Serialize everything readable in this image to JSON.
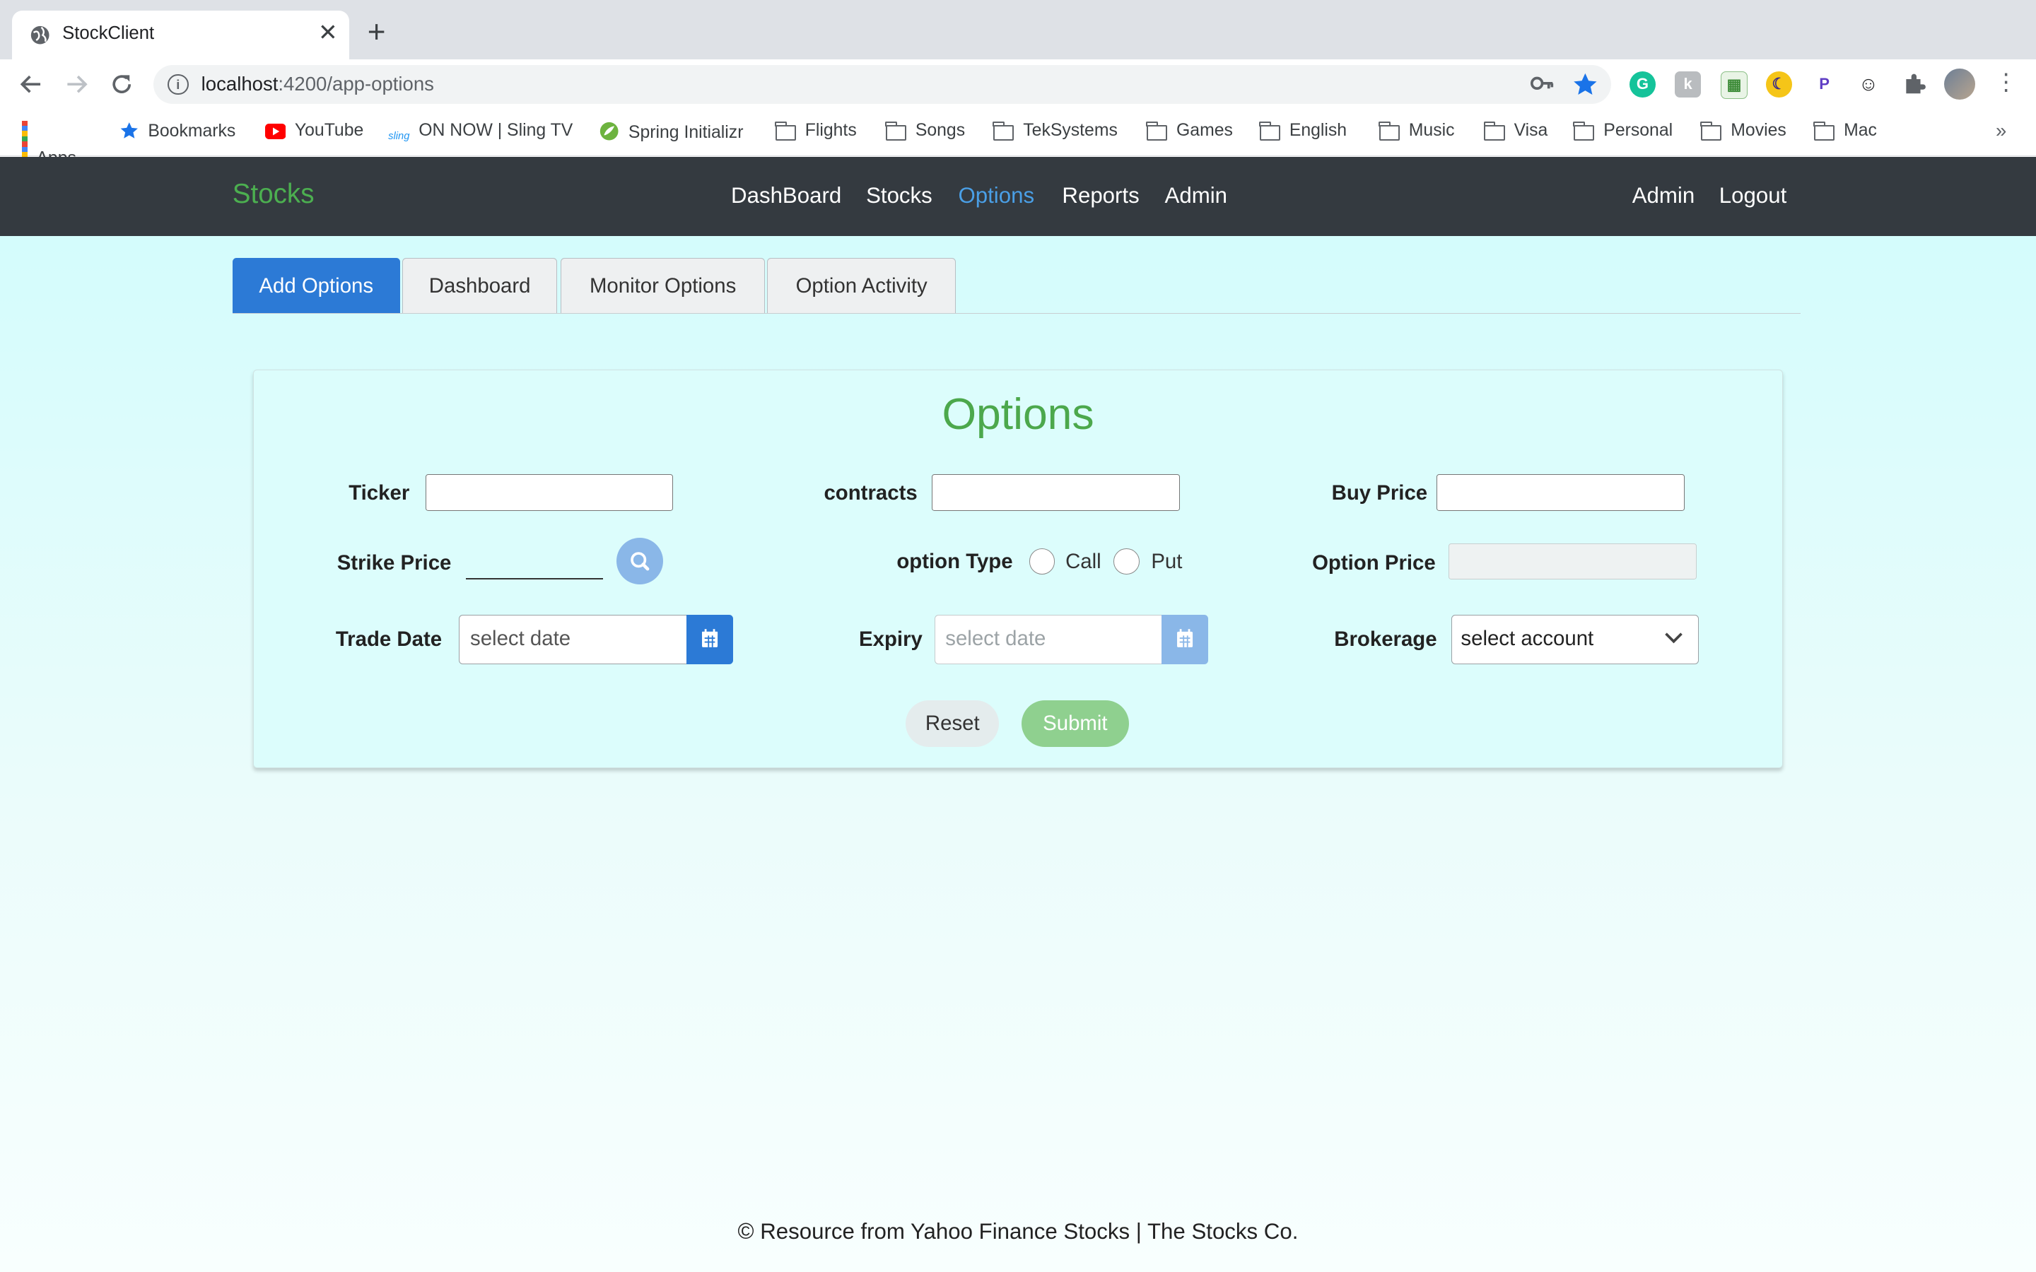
{
  "browser": {
    "tab_title": "StockClient",
    "close_glyph": "✕",
    "new_tab_glyph": "+",
    "url_host": "localhost",
    "url_path": ":4200/app-options",
    "bookmarks": [
      {
        "label": "Apps",
        "icon": "apps-grid-icon"
      },
      {
        "label": "Bookmarks",
        "icon": "star-icon"
      },
      {
        "label": "YouTube",
        "icon": "youtube-icon"
      },
      {
        "label": "ON NOW | Sling TV",
        "icon": "sling-icon"
      },
      {
        "label": "Spring Initializr",
        "icon": "spring-icon"
      },
      {
        "label": "Flights",
        "icon": "folder-icon"
      },
      {
        "label": "Songs",
        "icon": "folder-icon"
      },
      {
        "label": "TekSystems",
        "icon": "folder-icon"
      },
      {
        "label": "Games",
        "icon": "folder-icon"
      },
      {
        "label": "English",
        "icon": "folder-icon"
      },
      {
        "label": "Music",
        "icon": "folder-icon"
      },
      {
        "label": "Visa",
        "icon": "folder-icon"
      },
      {
        "label": "Personal",
        "icon": "folder-icon"
      },
      {
        "label": "Movies",
        "icon": "folder-icon"
      },
      {
        "label": "Mac",
        "icon": "folder-icon"
      }
    ],
    "sling_text": "sling",
    "overflow_glyph": "»"
  },
  "navbar": {
    "brand": "Stocks",
    "links": [
      "DashBoard",
      "Stocks",
      "Options",
      "Reports",
      "Admin"
    ],
    "active_link": "Options",
    "right_links": [
      "Admin",
      "Logout"
    ]
  },
  "tabs": [
    "Add Options",
    "Dashboard",
    "Monitor Options",
    "Option Activity"
  ],
  "active_tab": "Add Options",
  "form": {
    "title": "Options",
    "ticker_label": "Ticker",
    "ticker_value": "",
    "contracts_label": "contracts",
    "contracts_value": "",
    "buy_price_label": "Buy Price",
    "buy_price_value": "",
    "strike_price_label": "Strike Price",
    "strike_price_value": "",
    "option_type_label": "option Type",
    "option_type_options": [
      "Call",
      "Put"
    ],
    "option_price_label": "Option Price",
    "option_price_value": "",
    "trade_date_label": "Trade Date",
    "trade_date_placeholder": "select date",
    "expiry_label": "Expiry",
    "expiry_placeholder": "select date",
    "brokerage_label": "Brokerage",
    "brokerage_selected": "select account",
    "reset_label": "Reset",
    "submit_label": "Submit"
  },
  "footer": "© Resource from Yahoo Finance Stocks | The Stocks Co.",
  "colors": {
    "navbar_bg": "#343a40",
    "brand": "#4caf50",
    "active_link": "#4a9fe6",
    "primary": "#2c7ad6",
    "submit_disabled": "#8fd08f",
    "title_green": "#4ca84c",
    "page_bg_top": "#d4fcfc"
  }
}
